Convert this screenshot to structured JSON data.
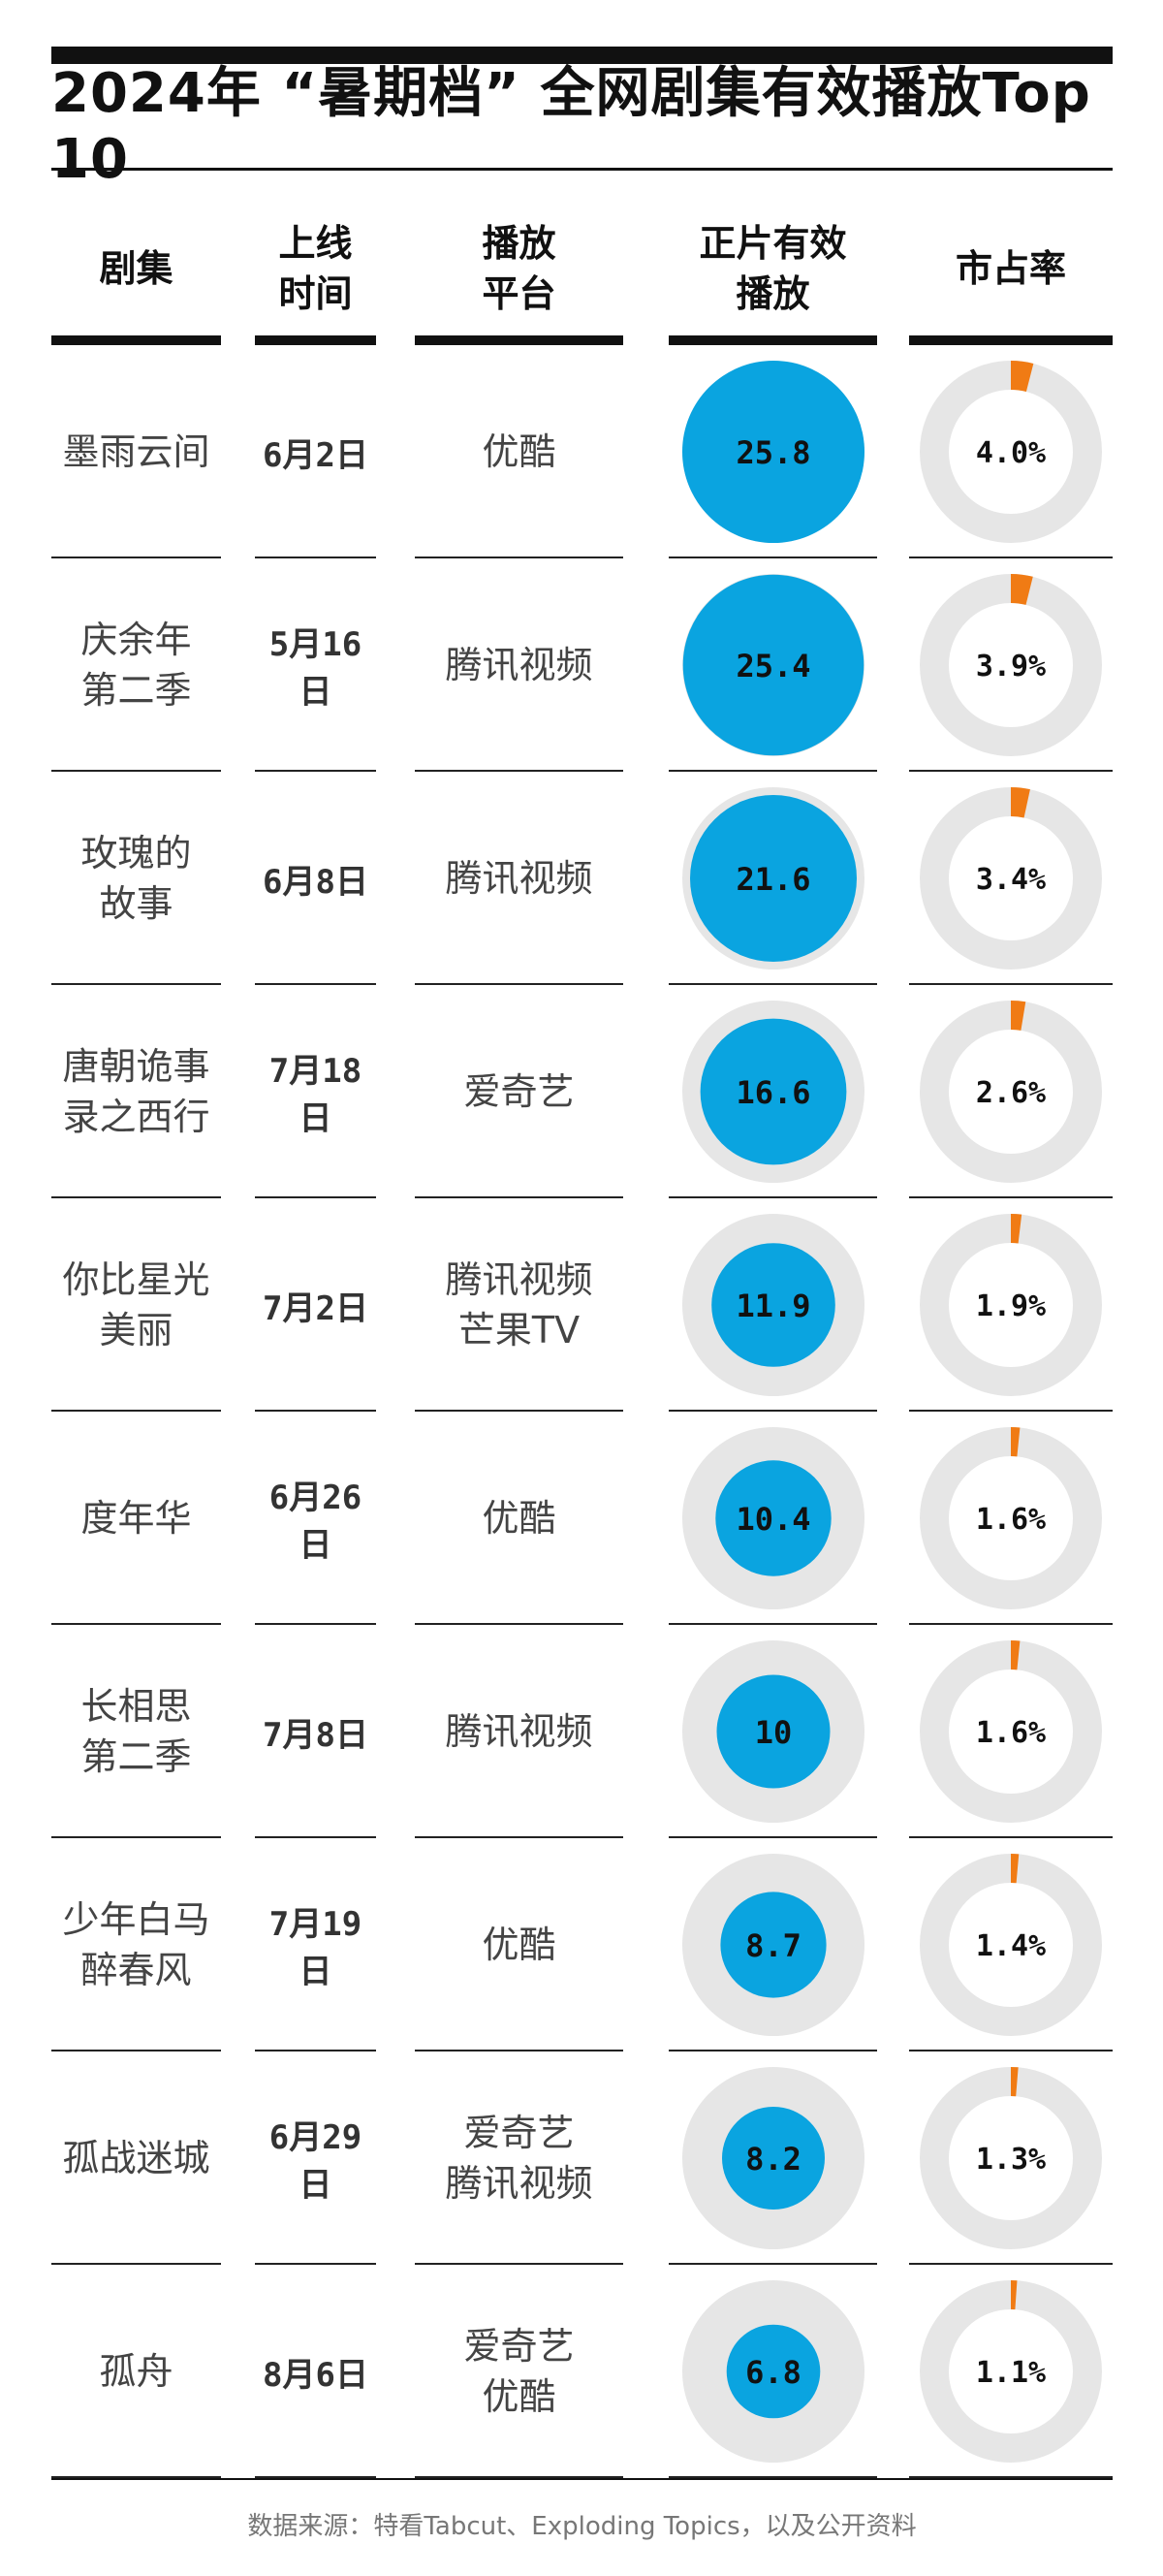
{
  "title": "2024年 “暑期档” 全网剧集有效播放Top 10",
  "headers": {
    "drama": "剧集",
    "launch": "上线\n时间",
    "platform": "播放\n平台",
    "views": "正片有效\n播放",
    "share": "市占率"
  },
  "colors": {
    "bubble": "#0aa4e0",
    "bubble_ring": "#e6e6e6",
    "share_accent": "#f07b14",
    "share_track": "#e6e6e6"
  },
  "chart_data": {
    "type": "table",
    "columns": [
      "剧集",
      "上线时间",
      "播放平台",
      "正片有效播放",
      "市占率"
    ],
    "rows": [
      {
        "name": "墨雨云间",
        "date": "6月2日",
        "platform": "优酷",
        "views": 25.8,
        "views_label": "25.8",
        "share": 4.0,
        "share_label": "4.0%"
      },
      {
        "name": "庆余年\n第二季",
        "date": "5月16日",
        "platform": "腾讯视频",
        "views": 25.4,
        "views_label": "25.4",
        "share": 3.9,
        "share_label": "3.9%"
      },
      {
        "name": "玫瑰的\n故事",
        "date": "6月8日",
        "platform": "腾讯视频",
        "views": 21.6,
        "views_label": "21.6",
        "share": 3.4,
        "share_label": "3.4%"
      },
      {
        "name": "唐朝诡事\n录之西行",
        "date": "7月18日",
        "platform": "爱奇艺",
        "views": 16.6,
        "views_label": "16.6",
        "share": 2.6,
        "share_label": "2.6%"
      },
      {
        "name": "你比星光\n美丽",
        "date": "7月2日",
        "platform": "腾讯视频\n芒果TV",
        "views": 11.9,
        "views_label": "11.9",
        "share": 1.9,
        "share_label": "1.9%"
      },
      {
        "name": "度年华",
        "date": "6月26日",
        "platform": "优酷",
        "views": 10.4,
        "views_label": "10.4",
        "share": 1.6,
        "share_label": "1.6%"
      },
      {
        "name": "长相思\n第二季",
        "date": "7月8日",
        "platform": "腾讯视频",
        "views": 10,
        "views_label": "10",
        "share": 1.6,
        "share_label": "1.6%"
      },
      {
        "name": "少年白马\n醉春风",
        "date": "7月19日",
        "platform": "优酷",
        "views": 8.7,
        "views_label": "8.7",
        "share": 1.4,
        "share_label": "1.4%"
      },
      {
        "name": "孤战迷城",
        "date": "6月29日",
        "platform": "爱奇艺\n腾讯视频",
        "views": 8.2,
        "views_label": "8.2",
        "share": 1.3,
        "share_label": "1.3%"
      },
      {
        "name": "孤舟",
        "date": "8月6日",
        "platform": "爱奇艺\n优酷",
        "views": 6.8,
        "views_label": "6.8",
        "share": 1.1,
        "share_label": "1.1%"
      }
    ]
  },
  "source": "数据来源：特看Tabcut、Exploding Topics，以及公开资料"
}
